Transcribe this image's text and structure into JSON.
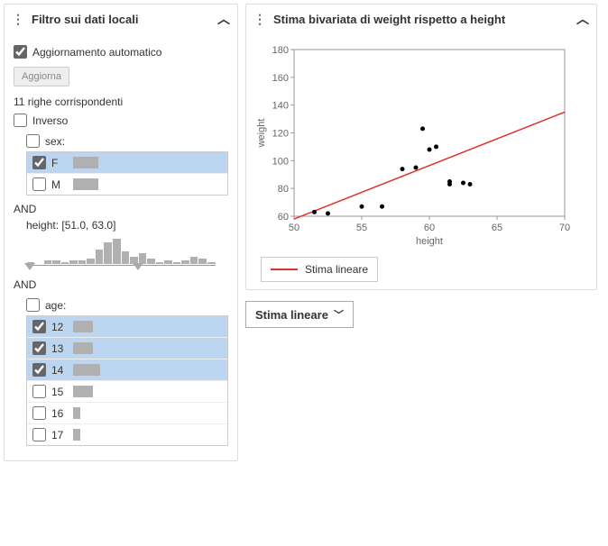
{
  "leftPanel": {
    "title": "Filtro sui dati locali",
    "autoUpdate": "Aggiornamento automatico",
    "refreshBtn": "Aggiorna",
    "matchText": "11 righe corrispondenti",
    "inverse": "Inverso",
    "sexLabel": "sex:",
    "sexOpts": [
      {
        "label": "F",
        "checked": true,
        "bar": 28
      },
      {
        "label": "M",
        "checked": false,
        "bar": 28
      }
    ],
    "and": "AND",
    "heightLabel": "height: [51.0, 63.0]",
    "histBars": [
      1,
      0,
      2,
      2,
      1,
      2,
      2,
      3,
      8,
      12,
      14,
      7,
      4,
      6,
      3,
      1,
      2,
      1,
      2,
      4,
      3,
      1
    ],
    "ageLabel": "age:",
    "ageOpts": [
      {
        "label": "12",
        "checked": true,
        "bar": 22
      },
      {
        "label": "13",
        "checked": true,
        "bar": 22
      },
      {
        "label": "14",
        "checked": true,
        "bar": 30
      },
      {
        "label": "15",
        "checked": false,
        "bar": 22
      },
      {
        "label": "16",
        "checked": false,
        "bar": 8
      },
      {
        "label": "17",
        "checked": false,
        "bar": 8
      }
    ]
  },
  "rightPanel": {
    "title": "Stima bivariata di weight rispetto a height",
    "ylabel": "weight",
    "xlabel": "height",
    "legend": "Stima lineare",
    "dropdown": "Stima lineare"
  },
  "chart_data": {
    "type": "scatter",
    "xlabel": "height",
    "ylabel": "weight",
    "xlim": [
      50,
      70
    ],
    "ylim": [
      60,
      180
    ],
    "xticks": [
      50,
      55,
      60,
      65,
      70
    ],
    "yticks": [
      60,
      80,
      100,
      120,
      140,
      160,
      180
    ],
    "points": [
      {
        "x": 51.5,
        "y": 63
      },
      {
        "x": 52.5,
        "y": 62
      },
      {
        "x": 55.0,
        "y": 67
      },
      {
        "x": 56.5,
        "y": 67
      },
      {
        "x": 58.0,
        "y": 94
      },
      {
        "x": 59.0,
        "y": 95
      },
      {
        "x": 59.5,
        "y": 123
      },
      {
        "x": 60.0,
        "y": 108
      },
      {
        "x": 60.5,
        "y": 110
      },
      {
        "x": 61.5,
        "y": 83
      },
      {
        "x": 61.5,
        "y": 85
      },
      {
        "x": 62.5,
        "y": 84
      },
      {
        "x": 63.0,
        "y": 83
      }
    ],
    "fit_line": {
      "x1": 50,
      "y1": 58,
      "x2": 70,
      "y2": 135
    }
  }
}
